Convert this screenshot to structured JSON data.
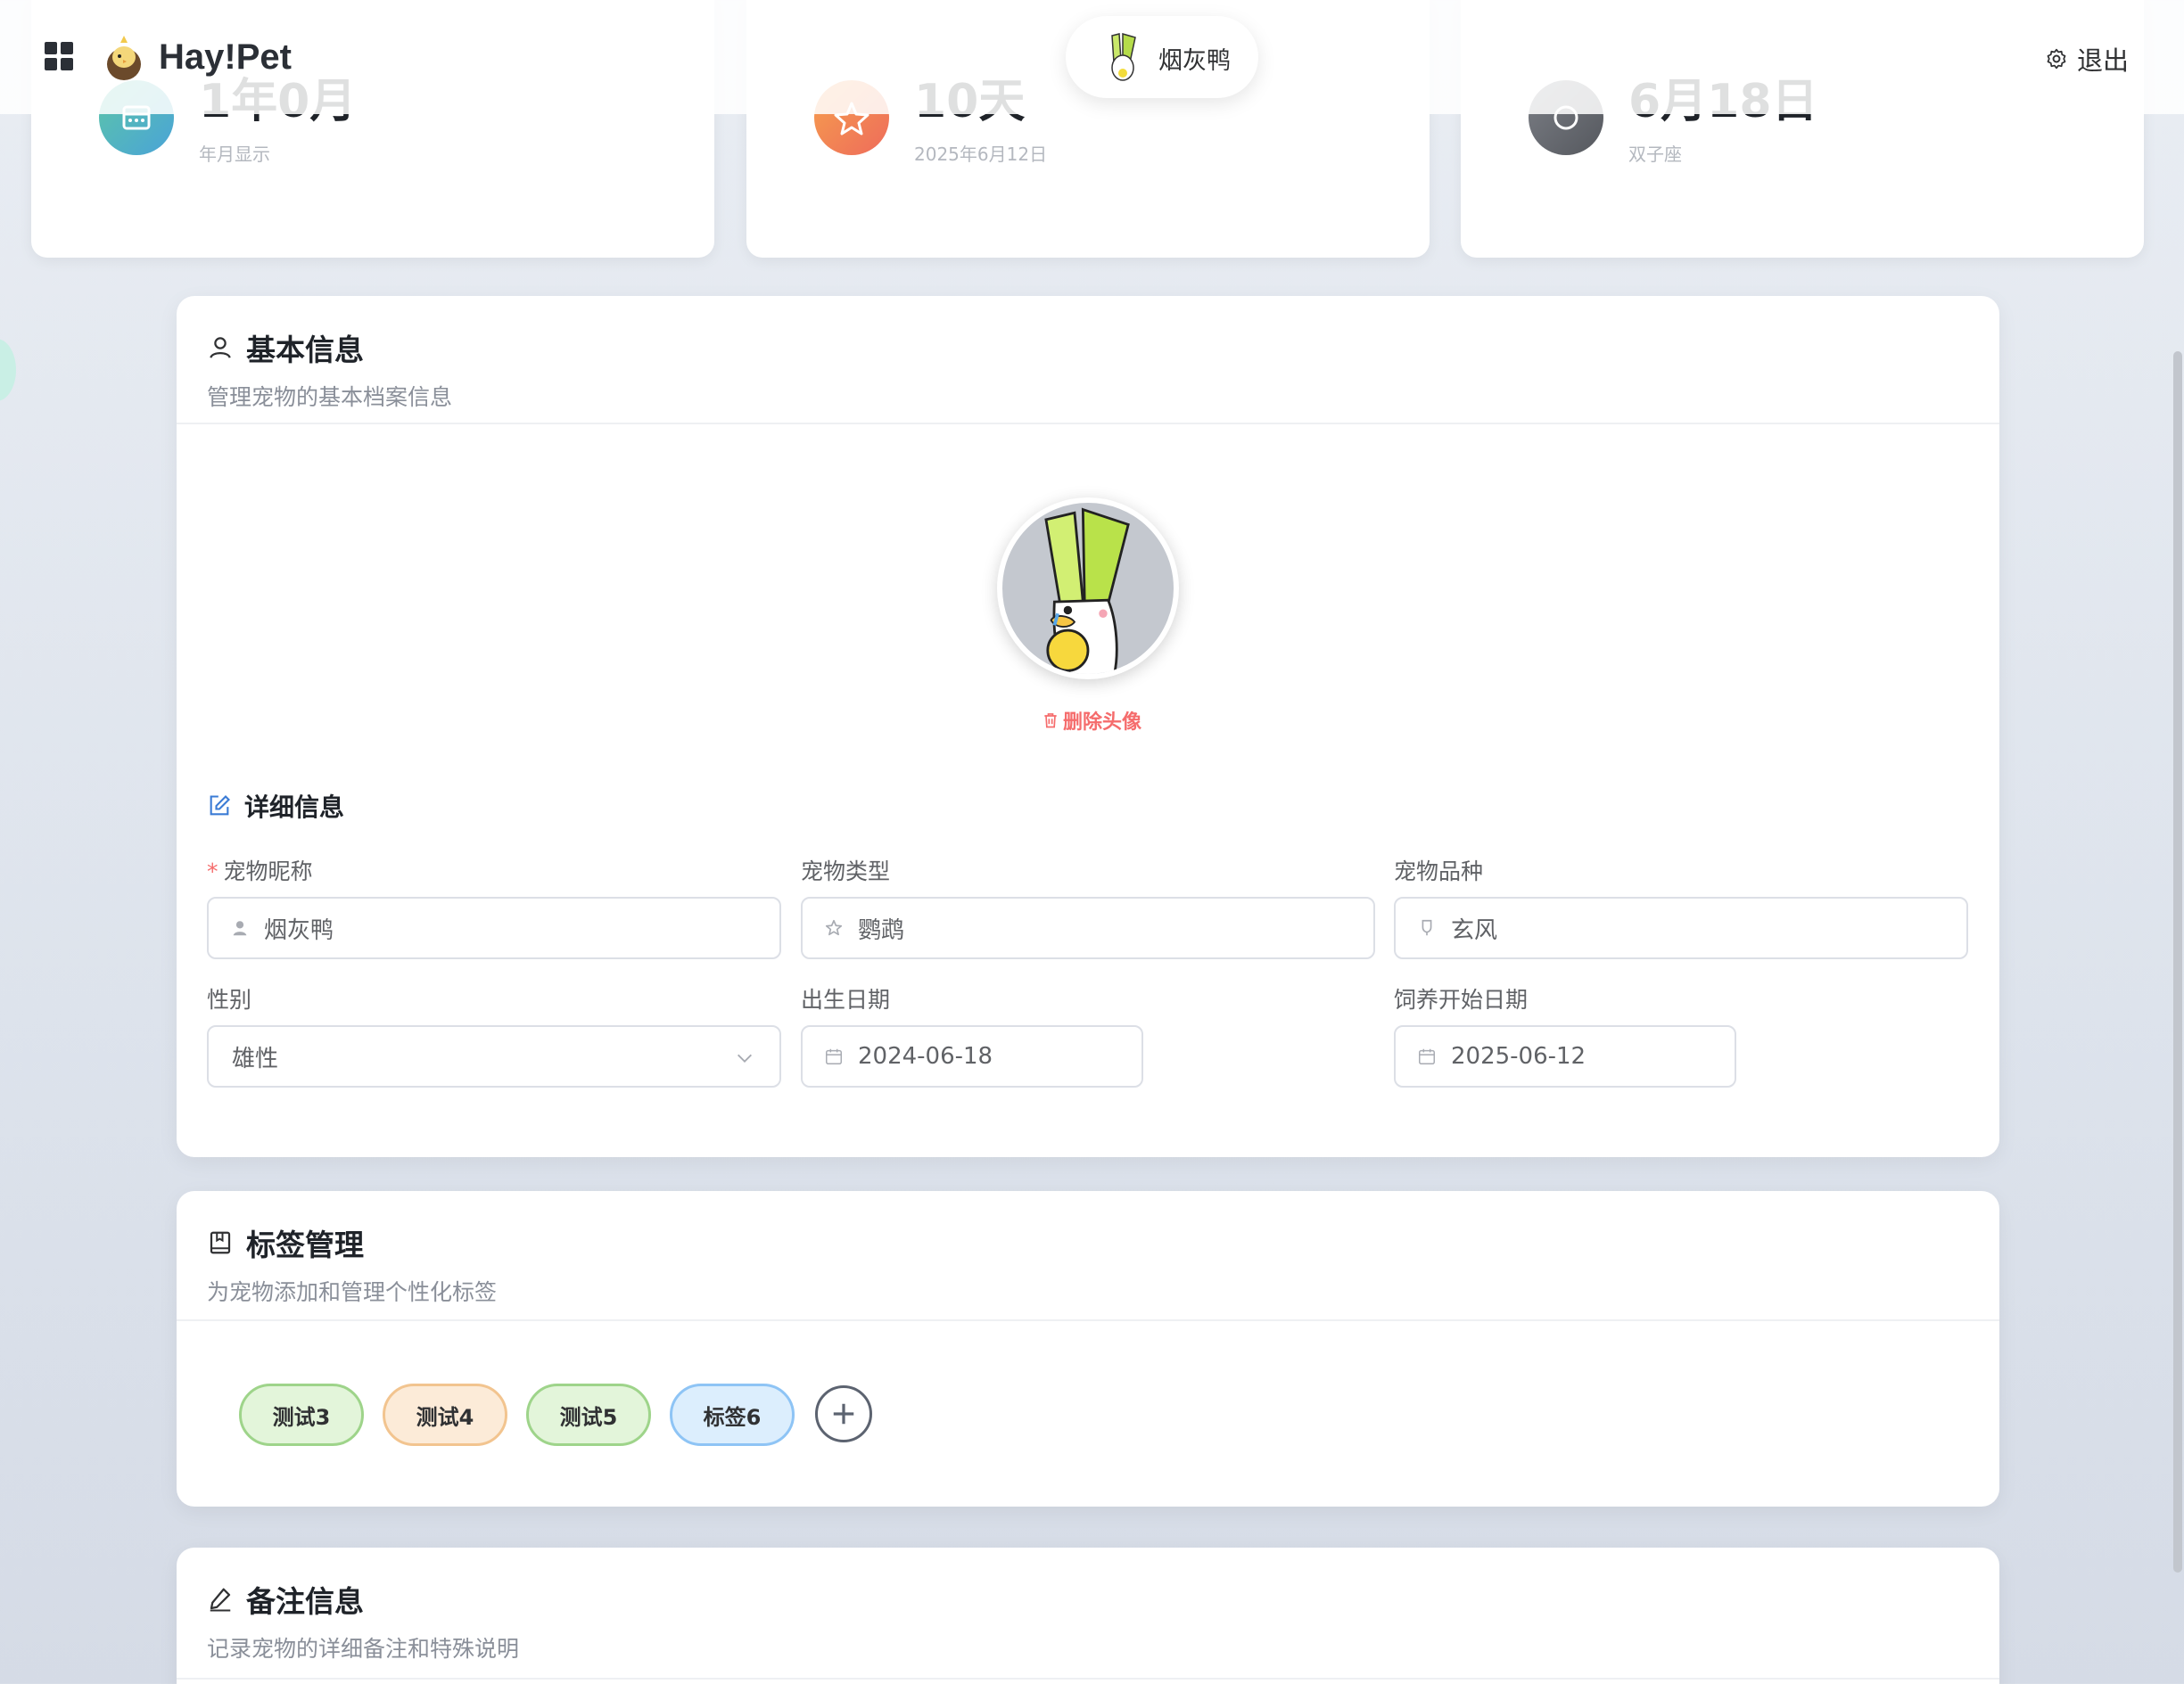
{
  "header": {
    "brand": "Hay!Pet",
    "pet_name": "烟灰鸭",
    "logout_label": "退出"
  },
  "stats": [
    {
      "value": "1年0月",
      "sub": "年月显示",
      "icon": "calendar-icon",
      "color": "#4fb3c9"
    },
    {
      "value": "10天",
      "sub": "2025年6月12日",
      "icon": "star-icon",
      "color": "#f08a5d"
    },
    {
      "value": "6月18日",
      "sub": "双子座",
      "icon": "clock-icon",
      "color": "#6b6e75"
    }
  ],
  "basic": {
    "title": "基本信息",
    "desc": "管理宠物的基本档案信息",
    "delete_avatar": "删除头像",
    "detail_title": "详细信息",
    "fields": {
      "nickname_label": "宠物昵称",
      "nickname_value": "烟灰鸭",
      "type_label": "宠物类型",
      "type_value": "鹦鹉",
      "breed_label": "宠物品种",
      "breed_value": "玄风",
      "gender_label": "性别",
      "gender_value": "雄性",
      "birth_label": "出生日期",
      "birth_value": "2024-06-18",
      "start_label": "饲养开始日期",
      "start_value": "2025-06-12"
    }
  },
  "tags": {
    "title": "标签管理",
    "desc": "为宠物添加和管理个性化标签",
    "items": [
      {
        "label": "测试3",
        "bg": "#e3f5da",
        "border": "#9ed48a"
      },
      {
        "label": "测试4",
        "bg": "#fcebd8",
        "border": "#f2c48f"
      },
      {
        "label": "测试5",
        "bg": "#e3f5da",
        "border": "#9ed48a"
      },
      {
        "label": "标签6",
        "bg": "#dceefd",
        "border": "#8ec4f5"
      }
    ]
  },
  "notes": {
    "title": "备注信息",
    "desc": "记录宠物的详细备注和特殊说明"
  }
}
